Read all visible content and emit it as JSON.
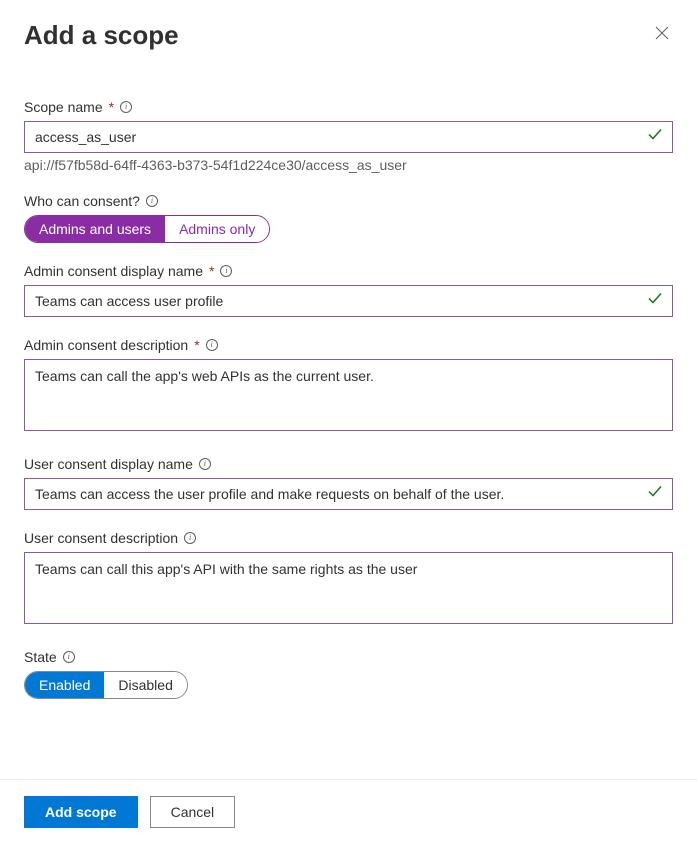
{
  "header": {
    "title": "Add a scope"
  },
  "fields": {
    "scopeName": {
      "label": "Scope name",
      "value": "access_as_user",
      "hint": "api://f57fb58d-64ff-4363-b373-54f1d224ce30/access_as_user"
    },
    "consent": {
      "label": "Who can consent?",
      "opt1": "Admins and users",
      "opt2": "Admins only"
    },
    "adminDisplayName": {
      "label": "Admin consent display name",
      "value": "Teams can access user profile"
    },
    "adminDescription": {
      "label": "Admin consent description",
      "value": "Teams can call the app's web APIs as the current user."
    },
    "userDisplayName": {
      "label": "User consent display name",
      "value": "Teams can access the user profile and make requests on behalf of the user."
    },
    "userDescription": {
      "label": "User consent description",
      "value": "Teams can call this app's API with the same rights as the user"
    },
    "state": {
      "label": "State",
      "opt1": "Enabled",
      "opt2": "Disabled"
    }
  },
  "footer": {
    "primary": "Add scope",
    "secondary": "Cancel"
  }
}
